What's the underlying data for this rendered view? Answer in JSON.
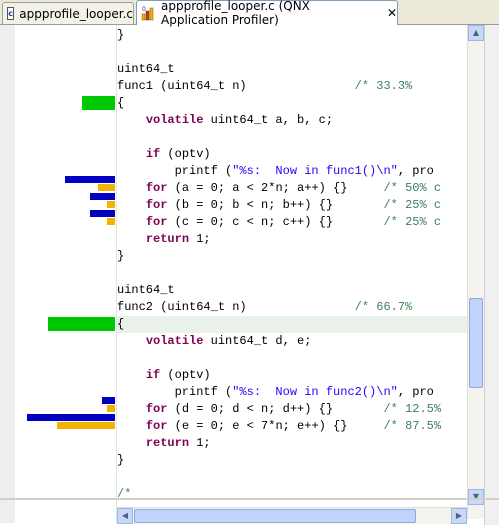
{
  "tabs": [
    {
      "label": "appprofile_looper.c",
      "icon": "c-file-icon",
      "active": false
    },
    {
      "label": "appprofile_looper.c (QNX Application Profiler)",
      "icon": "profiler-icon",
      "active": true,
      "close": "✕"
    }
  ],
  "code_lines": [
    {
      "segs": [
        {
          "t": "}",
          "c": ""
        }
      ]
    },
    {
      "segs": [
        {
          "t": "",
          "c": ""
        }
      ]
    },
    {
      "segs": [
        {
          "t": "uint64_t",
          "c": ""
        }
      ]
    },
    {
      "segs": [
        {
          "t": "func1 (uint64_t n)               ",
          "c": ""
        },
        {
          "t": "/* 33.3% ",
          "c": "cmt"
        }
      ]
    },
    {
      "segs": [
        {
          "t": "{",
          "c": ""
        }
      ]
    },
    {
      "segs": [
        {
          "t": "    ",
          "c": ""
        },
        {
          "t": "volatile",
          "c": "kw"
        },
        {
          "t": " uint64_t a, b, c;",
          "c": ""
        }
      ]
    },
    {
      "segs": [
        {
          "t": "",
          "c": ""
        }
      ]
    },
    {
      "segs": [
        {
          "t": "    ",
          "c": ""
        },
        {
          "t": "if",
          "c": "kw"
        },
        {
          "t": " (optv)",
          "c": ""
        }
      ]
    },
    {
      "segs": [
        {
          "t": "        printf (",
          "c": ""
        },
        {
          "t": "\"%s:  Now in func1()\\n\"",
          "c": "str"
        },
        {
          "t": ", pro",
          "c": ""
        }
      ]
    },
    {
      "segs": [
        {
          "t": "    ",
          "c": ""
        },
        {
          "t": "for",
          "c": "kw"
        },
        {
          "t": " (a = 0; a < 2*n; a++) {}     ",
          "c": ""
        },
        {
          "t": "/* 50% c",
          "c": "cmt"
        }
      ]
    },
    {
      "segs": [
        {
          "t": "    ",
          "c": ""
        },
        {
          "t": "for",
          "c": "kw"
        },
        {
          "t": " (b = 0; b < n; b++) {}       ",
          "c": ""
        },
        {
          "t": "/* 25% c",
          "c": "cmt"
        }
      ]
    },
    {
      "segs": [
        {
          "t": "    ",
          "c": ""
        },
        {
          "t": "for",
          "c": "kw"
        },
        {
          "t": " (c = 0; c < n; c++) {}       ",
          "c": ""
        },
        {
          "t": "/* 25% c",
          "c": "cmt"
        }
      ]
    },
    {
      "segs": [
        {
          "t": "    ",
          "c": ""
        },
        {
          "t": "return",
          "c": "kw"
        },
        {
          "t": " 1;",
          "c": ""
        }
      ]
    },
    {
      "segs": [
        {
          "t": "}",
          "c": ""
        }
      ]
    },
    {
      "segs": [
        {
          "t": "",
          "c": ""
        }
      ]
    },
    {
      "segs": [
        {
          "t": "uint64_t",
          "c": ""
        }
      ]
    },
    {
      "segs": [
        {
          "t": "func2 (uint64_t n)               ",
          "c": ""
        },
        {
          "t": "/* 66.7% ",
          "c": "cmt"
        }
      ]
    },
    {
      "segs": [
        {
          "t": "{",
          "c": ""
        }
      ],
      "hl": true
    },
    {
      "segs": [
        {
          "t": "    ",
          "c": ""
        },
        {
          "t": "volatile",
          "c": "kw"
        },
        {
          "t": " uint64_t d, e;",
          "c": ""
        }
      ]
    },
    {
      "segs": [
        {
          "t": "",
          "c": ""
        }
      ]
    },
    {
      "segs": [
        {
          "t": "    ",
          "c": ""
        },
        {
          "t": "if",
          "c": "kw"
        },
        {
          "t": " (optv)",
          "c": ""
        }
      ]
    },
    {
      "segs": [
        {
          "t": "        printf (",
          "c": ""
        },
        {
          "t": "\"%s:  Now in func2()\\n\"",
          "c": "str"
        },
        {
          "t": ", pro",
          "c": ""
        }
      ]
    },
    {
      "segs": [
        {
          "t": "    ",
          "c": ""
        },
        {
          "t": "for",
          "c": "kw"
        },
        {
          "t": " (d = 0; d < n; d++) {}       ",
          "c": ""
        },
        {
          "t": "/* 12.5%",
          "c": "cmt"
        }
      ]
    },
    {
      "segs": [
        {
          "t": "    ",
          "c": ""
        },
        {
          "t": "for",
          "c": "kw"
        },
        {
          "t": " (e = 0; e < 7*n; e++) {}     ",
          "c": ""
        },
        {
          "t": "/* 87.5%",
          "c": "cmt"
        }
      ]
    },
    {
      "segs": [
        {
          "t": "    ",
          "c": ""
        },
        {
          "t": "return",
          "c": "kw"
        },
        {
          "t": " 1;",
          "c": ""
        }
      ]
    },
    {
      "segs": [
        {
          "t": "}",
          "c": ""
        }
      ]
    },
    {
      "segs": [
        {
          "t": "",
          "c": ""
        }
      ]
    },
    {
      "segs": [
        {
          "t": "/*",
          "c": "cmt"
        }
      ]
    }
  ],
  "profile_bars": [
    {
      "line": 4,
      "kind": "green",
      "value": 0.333
    },
    {
      "line": 9,
      "kind": "blue",
      "value": 0.5
    },
    {
      "line": 9,
      "kind": "yellow",
      "value": 0.167
    },
    {
      "line": 10,
      "kind": "blue",
      "value": 0.25
    },
    {
      "line": 10,
      "kind": "yellow",
      "value": 0.083
    },
    {
      "line": 11,
      "kind": "blue",
      "value": 0.25
    },
    {
      "line": 11,
      "kind": "yellow",
      "value": 0.083
    },
    {
      "line": 17,
      "kind": "green",
      "value": 0.667
    },
    {
      "line": 22,
      "kind": "blue",
      "value": 0.125
    },
    {
      "line": 22,
      "kind": "yellow",
      "value": 0.083
    },
    {
      "line": 23,
      "kind": "blue",
      "value": 0.875
    },
    {
      "line": 23,
      "kind": "yellow",
      "value": 0.583
    }
  ],
  "colors": {
    "blue": "#0000c0",
    "yellow": "#f0b400",
    "green": "#00c800",
    "keyword": "#7f0055",
    "string": "#2a00ff",
    "comment": "#3f7f5f"
  }
}
